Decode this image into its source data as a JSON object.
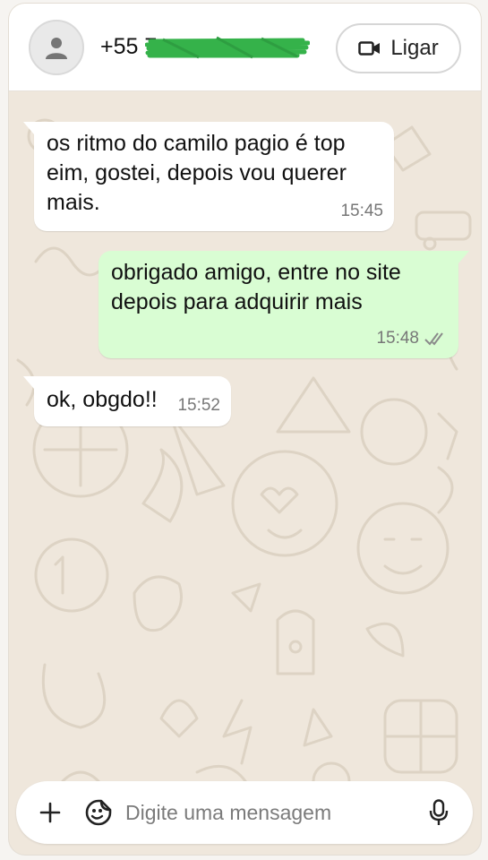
{
  "header": {
    "contact_name": "+55 7",
    "call_label": "Ligar",
    "icons": {
      "avatar": "person-icon",
      "call": "video-camera-icon"
    }
  },
  "messages": [
    {
      "direction": "incoming",
      "text": "os ritmo do camilo pagio é top eim, gostei, depois vou querer mais.",
      "time": "15:45"
    },
    {
      "direction": "outgoing",
      "text": "obrigado amigo, entre no site depois para adquirir mais",
      "time": "15:48",
      "status": "read-double-check"
    },
    {
      "direction": "incoming",
      "text": "ok, obgdo!!",
      "time": "15:52"
    }
  ],
  "composer": {
    "placeholder": "Digite uma mensagem",
    "value": "",
    "icons": {
      "attach": "plus-icon",
      "sticker": "sticker-icon",
      "voice": "microphone-icon"
    }
  },
  "colors": {
    "chat_background": "#efe7dc",
    "incoming_bubble": "#ffffff",
    "outgoing_bubble": "#d9fdd3",
    "redaction": "#35b24a"
  }
}
